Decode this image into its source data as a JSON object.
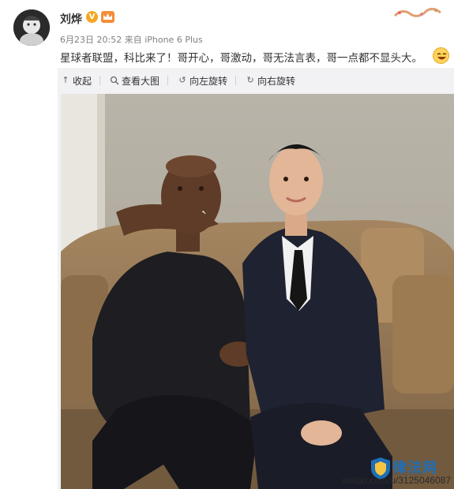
{
  "post": {
    "username": "刘烨",
    "verified_icon": "verified-v-icon",
    "member_icon": "member-badge-icon",
    "meta_time": "6月23日 20:52",
    "meta_source": "来自 iPhone 6 Plus",
    "text": "星球者联盟，科比来了！哥开心，哥激动，哥无法言表，哥一点都不显头大。",
    "emoji": "laughing-emoji-icon"
  },
  "toolbar": {
    "collapse_label": "收起",
    "view_large_label": "查看大图",
    "rotate_left_label": "向左旋转",
    "rotate_right_label": "向右旋转"
  },
  "watermark": {
    "url": "weibo.com/u/3125046087",
    "logo_text": "律法网",
    "logo_sub": "88148.COM"
  },
  "colors": {
    "brand_blue": "#1f6fb7",
    "card_bg": "#f2f2f5",
    "meta_gray": "#808080"
  }
}
